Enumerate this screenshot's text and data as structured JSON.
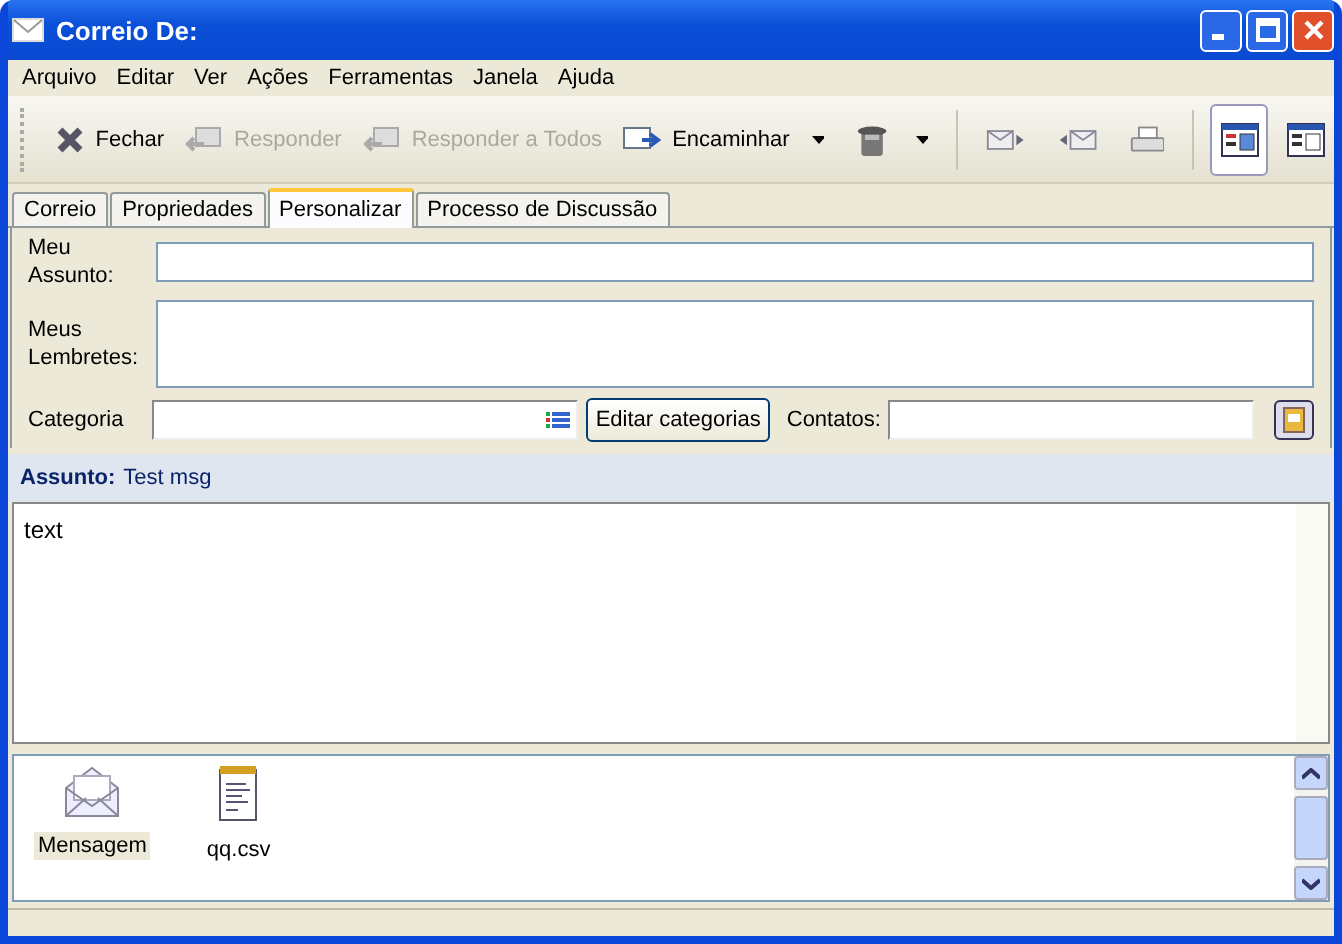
{
  "window": {
    "title": "Correio De:"
  },
  "menu": [
    "Arquivo",
    "Editar",
    "Ver",
    "Ações",
    "Ferramentas",
    "Janela",
    "Ajuda"
  ],
  "toolbar": [
    {
      "label": "Fechar",
      "disabled": false,
      "dropdown": false
    },
    {
      "label": "Responder",
      "disabled": true,
      "dropdown": false
    },
    {
      "label": "Responder a Todos",
      "disabled": true,
      "dropdown": false
    },
    {
      "label": "Encaminhar",
      "disabled": false,
      "dropdown": true
    }
  ],
  "views": [
    {
      "selected": true
    },
    {
      "selected": false
    }
  ],
  "tabs": [
    {
      "label": "Correio",
      "selected": false
    },
    {
      "label": "Propriedades",
      "selected": false
    },
    {
      "label": "Personalizar",
      "selected": true
    },
    {
      "label": "Processo de Discussão",
      "selected": false
    }
  ],
  "form": {
    "subject_label": "Meu Assunto:",
    "reminders_label": "Meus Lembretes:",
    "category_label": "Categoria",
    "edit_categories": "Editar categorias",
    "contacts_label": "Contatos:"
  },
  "subject": {
    "label": "Assunto:",
    "value": "Test msg"
  },
  "body": "text",
  "attachments": [
    {
      "kind": "message",
      "name": "Mensagem",
      "selected": true
    },
    {
      "kind": "file",
      "name": "qq.csv",
      "selected": false
    }
  ]
}
